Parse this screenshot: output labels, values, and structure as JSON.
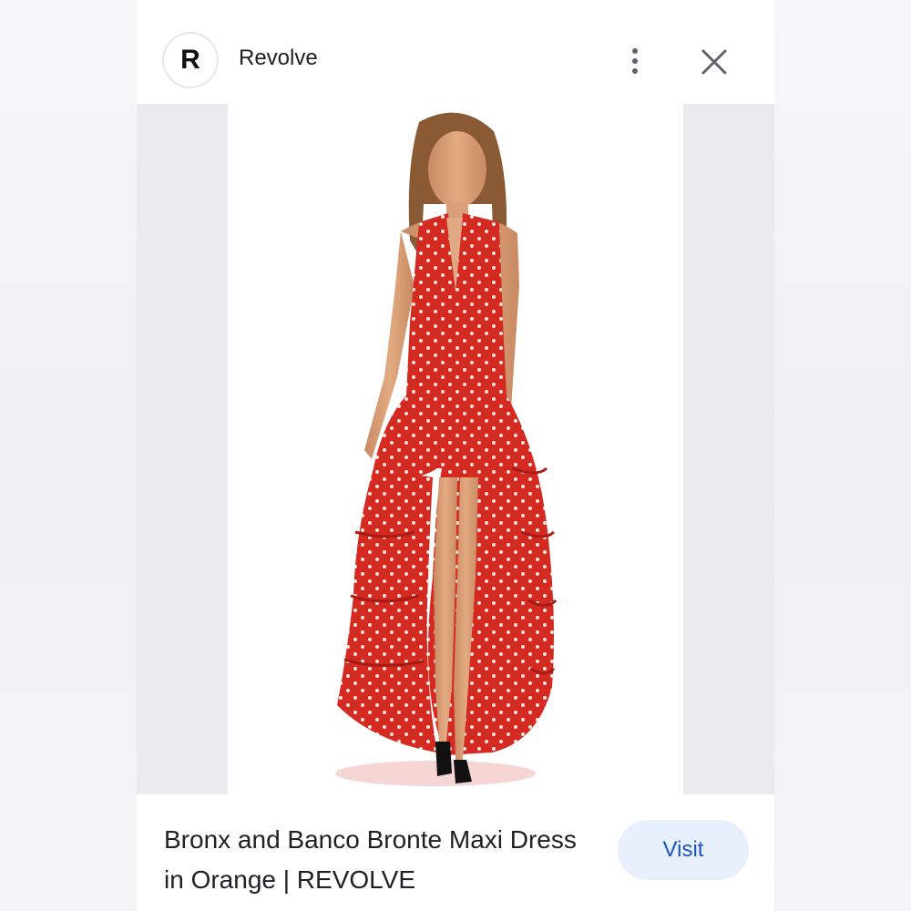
{
  "header": {
    "logo_letter": "R",
    "site_name": "Revolve",
    "more_icon": "more-vert-icon",
    "close_icon": "close-icon"
  },
  "product": {
    "image_alt": "model wearing red polka dot halter high-low ruffle maxi dress",
    "title": "Bronx and Banco Bronte Maxi Dress in Orange | REVOLVE"
  },
  "actions": {
    "visit_label": "Visit"
  },
  "colors": {
    "dress": "#d42a22",
    "visit_bg": "#e8f0fe",
    "visit_text": "#1a56c4"
  }
}
